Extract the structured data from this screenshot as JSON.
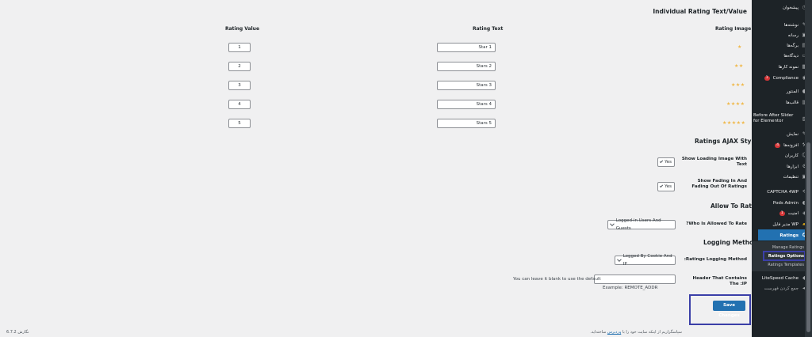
{
  "section_individual": "Individual Rating Text/Value",
  "columns": {
    "image": "Rating Image",
    "text": "Rating Text",
    "value": "Rating Value"
  },
  "rows": [
    {
      "stars": "★",
      "text": "Star 1",
      "value": "1"
    },
    {
      "stars": "★★",
      "text": "Stars 2",
      "value": "2"
    },
    {
      "stars": "★★★",
      "text": "Stars 3",
      "value": "3"
    },
    {
      "stars": "★★★★",
      "text": "Stars 4",
      "value": "4"
    },
    {
      "stars": "★★★★★",
      "text": "Stars 5",
      "value": "5"
    }
  ],
  "section_ajax": "Ratings AJAX Style",
  "show_loading_label": "Show Loading Image With Text",
  "show_loading_value": "Yes",
  "show_fading_label": "Show Fading In And Fading Out Of Ratings",
  "show_fading_value": "Yes",
  "section_allow": "Allow To Rate",
  "who_allowed_label": "?Who Is Allowed To Rate",
  "who_allowed_value": "Logged-in Users And Guests",
  "section_logging": "Logging Method",
  "logging_label": ":Ratings Logging Method",
  "logging_value": "Logged By Cookie And IP",
  "header_ip_label": "Header That Contains The :IP",
  "header_ip_value": "",
  "header_ip_note": "You can leave it blank to use the default",
  "header_ip_example": "Example: REMOTE_ADDR",
  "save_button": "Save Changes",
  "footer_left": "نگارش 6.7.2",
  "footer_right_text": "سپاسگزاریم از اینکه سایت خود را با",
  "footer_right_link": "وردپرس",
  "footer_right_tail": "ساخته‌اید.",
  "sidebar": {
    "items": [
      {
        "label": "پیشخوان",
        "icon": "dashboard-icon"
      },
      {
        "label": "نوشته‌ها",
        "icon": "pin-icon"
      },
      {
        "label": "رسانه",
        "icon": "media-icon"
      },
      {
        "label": "برگه‌ها",
        "icon": "page-icon"
      },
      {
        "label": "دیدگاه‌ها",
        "icon": "comment-icon"
      },
      {
        "label": "نمونه کارها",
        "icon": "portfolio-icon"
      },
      {
        "label": "Compliance",
        "icon": "compliance-icon",
        "badge": "1"
      },
      {
        "label": "المنتور",
        "icon": "elementor-icon"
      },
      {
        "label": "قالب‌ها",
        "icon": "template-icon"
      },
      {
        "label": "Before After Slider for Elementor",
        "icon": "slider-icon"
      },
      {
        "label": "نمایش",
        "icon": "brush-icon"
      },
      {
        "label": "افزونه‌ها",
        "icon": "plugin-icon",
        "badge": "4"
      },
      {
        "label": "کاربران",
        "icon": "user-icon"
      },
      {
        "label": "ابزارها",
        "icon": "tools-icon"
      },
      {
        "label": "تنظیمات",
        "icon": "settings-icon"
      },
      {
        "label": "CAPTCHA 4WP",
        "icon": "captcha-icon"
      },
      {
        "label": "Pods Admin",
        "icon": "pods-icon"
      },
      {
        "label": "امنیت",
        "icon": "security-icon",
        "badge": "1"
      },
      {
        "label": "WP مدیر فایل",
        "icon": "folder-icon"
      },
      {
        "label": "Ratings",
        "icon": "ratings-icon"
      },
      {
        "label": "LiteSpeed Cache",
        "icon": "litespeed-icon"
      },
      {
        "label": "جمع کردن فهرست",
        "icon": "collapse-icon"
      }
    ],
    "submenu": [
      "Manage Ratings",
      "Ratings Options",
      "Ratings Templates"
    ]
  }
}
